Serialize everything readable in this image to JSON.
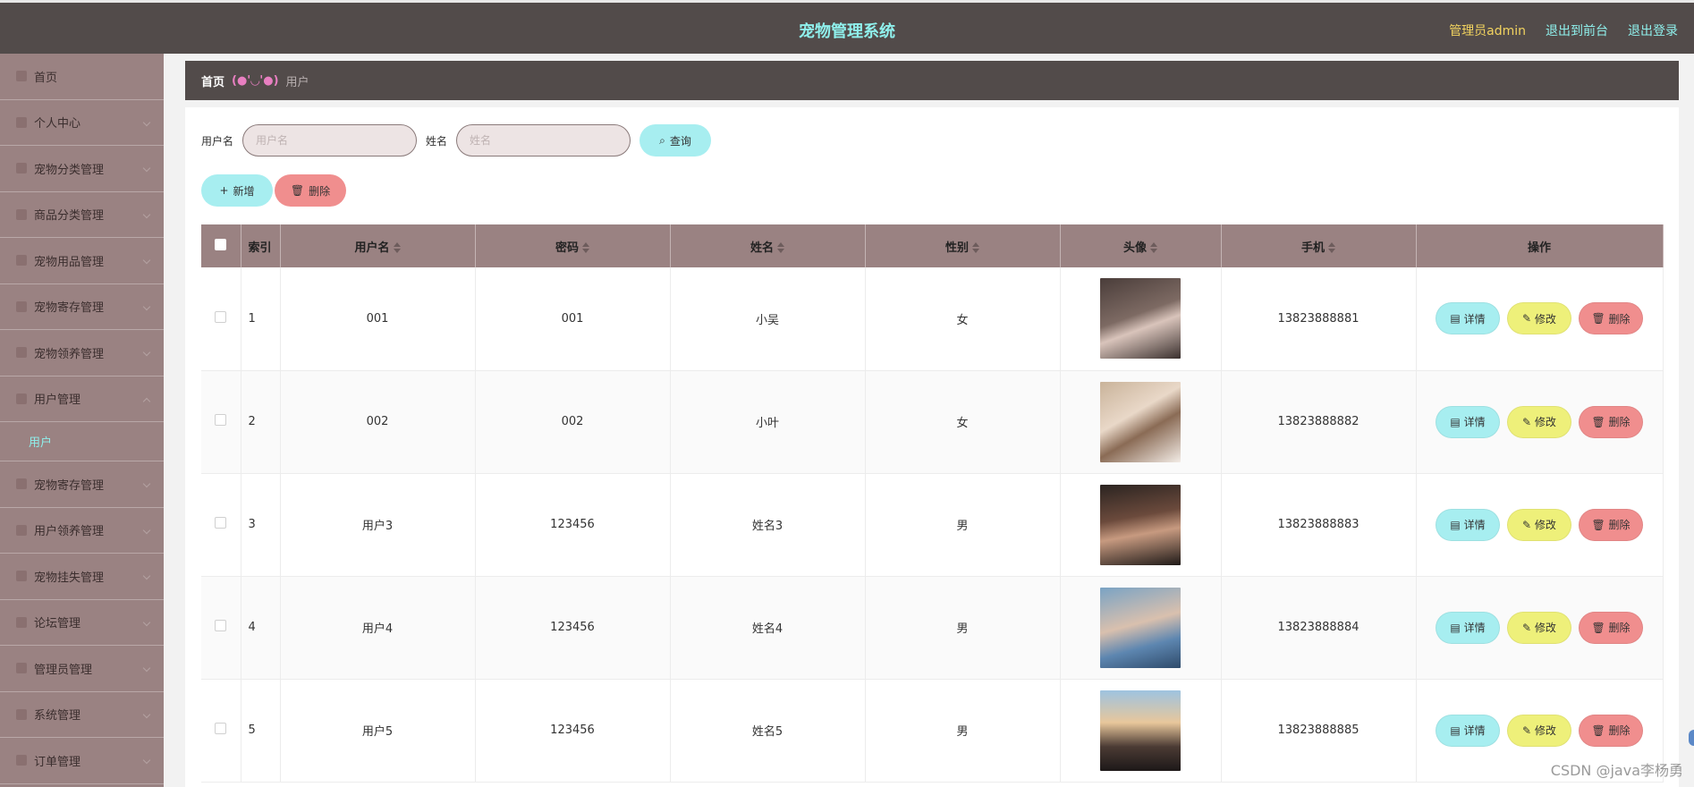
{
  "header": {
    "title": "宠物管理系统",
    "admin_label": "管理员admin",
    "front_link": "退出到前台",
    "logout_link": "退出登录"
  },
  "sidebar": {
    "items": [
      {
        "label": "首页"
      },
      {
        "label": "个人中心"
      },
      {
        "label": "宠物分类管理"
      },
      {
        "label": "商品分类管理"
      },
      {
        "label": "宠物用品管理"
      },
      {
        "label": "宠物寄存管理"
      },
      {
        "label": "宠物领养管理"
      },
      {
        "label": "用户管理",
        "sub": "用户"
      },
      {
        "label": "宠物寄存管理"
      },
      {
        "label": "用户领养管理"
      },
      {
        "label": "宠物挂失管理"
      },
      {
        "label": "论坛管理"
      },
      {
        "label": "管理员管理"
      },
      {
        "label": "系统管理"
      },
      {
        "label": "订单管理"
      }
    ]
  },
  "breadcrumb": {
    "home": "首页",
    "separator": "(●'◡'●)",
    "current": "用户"
  },
  "search": {
    "username_label": "用户名",
    "username_placeholder": "用户名",
    "name_label": "姓名",
    "name_placeholder": "姓名",
    "query_button": "查询"
  },
  "toolbar": {
    "add_button": "新增",
    "delete_button": "删除"
  },
  "table": {
    "columns": [
      "索引",
      "用户名",
      "密码",
      "姓名",
      "性别",
      "头像",
      "手机",
      "操作"
    ],
    "rows": [
      {
        "index": "1",
        "username": "001",
        "password": "001",
        "name": "小吴",
        "gender": "女",
        "phone": "13823888881"
      },
      {
        "index": "2",
        "username": "002",
        "password": "002",
        "name": "小叶",
        "gender": "女",
        "phone": "13823888882"
      },
      {
        "index": "3",
        "username": "用户3",
        "password": "123456",
        "name": "姓名3",
        "gender": "男",
        "phone": "13823888883"
      },
      {
        "index": "4",
        "username": "用户4",
        "password": "123456",
        "name": "姓名4",
        "gender": "男",
        "phone": "13823888884"
      },
      {
        "index": "5",
        "username": "用户5",
        "password": "123456",
        "name": "姓名5",
        "gender": "男",
        "phone": "13823888885"
      }
    ],
    "actions": {
      "detail": "详情",
      "edit": "修改",
      "remove": "删除"
    }
  },
  "watermark": "CSDN @java李杨勇",
  "colors": {
    "header_bg": "#524b4a",
    "sidebar_bg": "#9a8282",
    "accent_cyan": "#a7eef0",
    "accent_yellow": "#eef07a",
    "accent_red": "#f08e8e",
    "title_color": "#8ff0ec",
    "admin_color": "#f2d35f"
  }
}
